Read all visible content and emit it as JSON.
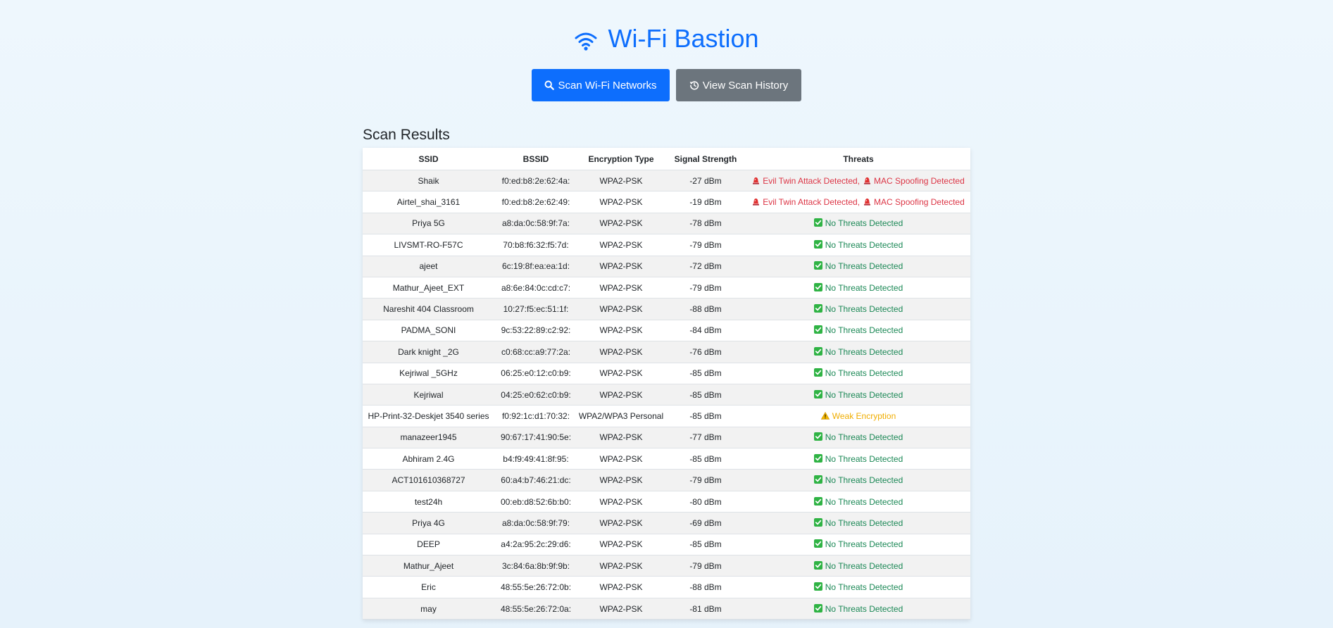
{
  "header": {
    "title": "Wi-Fi Bastion",
    "icon": "wifi-icon",
    "accent_color": "#0d6efd"
  },
  "actions": {
    "scan_label": "Scan Wi-Fi Networks",
    "history_label": "View Scan History"
  },
  "results": {
    "title": "Scan Results",
    "columns": [
      "SSID",
      "BSSID",
      "Encryption Type",
      "Signal Strength",
      "Threats"
    ],
    "threat_labels": {
      "evil_twin": "Evil Twin Attack Detected,",
      "mac_spoof": "MAC Spoofing Detected",
      "none": "No Threats Detected",
      "weak": "Weak Encryption"
    },
    "rows": [
      {
        "ssid": "Shaik",
        "bssid": "f0:ed:b8:2e:62:4a:",
        "encryption": "WPA2-PSK",
        "signal": "-27 dBm",
        "threat": "danger"
      },
      {
        "ssid": "Airtel_shai_3161",
        "bssid": "f0:ed:b8:2e:62:49:",
        "encryption": "WPA2-PSK",
        "signal": "-19 dBm",
        "threat": "danger"
      },
      {
        "ssid": "Priya 5G",
        "bssid": "a8:da:0c:58:9f:7a:",
        "encryption": "WPA2-PSK",
        "signal": "-78 dBm",
        "threat": "none"
      },
      {
        "ssid": "LIVSMT-RO-F57C",
        "bssid": "70:b8:f6:32:f5:7d:",
        "encryption": "WPA2-PSK",
        "signal": "-79 dBm",
        "threat": "none"
      },
      {
        "ssid": "ajeet",
        "bssid": "6c:19:8f:ea:ea:1d:",
        "encryption": "WPA2-PSK",
        "signal": "-72 dBm",
        "threat": "none"
      },
      {
        "ssid": "Mathur_Ajeet_EXT",
        "bssid": "a8:6e:84:0c:cd:c7:",
        "encryption": "WPA2-PSK",
        "signal": "-79 dBm",
        "threat": "none"
      },
      {
        "ssid": "Nareshit 404 Classroom",
        "bssid": "10:27:f5:ec:51:1f:",
        "encryption": "WPA2-PSK",
        "signal": "-88 dBm",
        "threat": "none"
      },
      {
        "ssid": "PADMA_SONI",
        "bssid": "9c:53:22:89:c2:92:",
        "encryption": "WPA2-PSK",
        "signal": "-84 dBm",
        "threat": "none"
      },
      {
        "ssid": "Dark knight _2G",
        "bssid": "c0:68:cc:a9:77:2a:",
        "encryption": "WPA2-PSK",
        "signal": "-76 dBm",
        "threat": "none"
      },
      {
        "ssid": "Kejriwal _5GHz",
        "bssid": "06:25:e0:12:c0:b9:",
        "encryption": "WPA2-PSK",
        "signal": "-85 dBm",
        "threat": "none"
      },
      {
        "ssid": "Kejriwal",
        "bssid": "04:25:e0:62:c0:b9:",
        "encryption": "WPA2-PSK",
        "signal": "-85 dBm",
        "threat": "none"
      },
      {
        "ssid": "HP-Print-32-Deskjet 3540 series",
        "bssid": "f0:92:1c:d1:70:32:",
        "encryption": "WPA2/WPA3 Personal",
        "signal": "-85 dBm",
        "threat": "weak"
      },
      {
        "ssid": "manazeer1945",
        "bssid": "90:67:17:41:90:5e:",
        "encryption": "WPA2-PSK",
        "signal": "-77 dBm",
        "threat": "none"
      },
      {
        "ssid": "Abhiram 2.4G",
        "bssid": "b4:f9:49:41:8f:95:",
        "encryption": "WPA2-PSK",
        "signal": "-85 dBm",
        "threat": "none"
      },
      {
        "ssid": "ACT101610368727",
        "bssid": "60:a4:b7:46:21:dc:",
        "encryption": "WPA2-PSK",
        "signal": "-79 dBm",
        "threat": "none"
      },
      {
        "ssid": "test24h",
        "bssid": "00:eb:d8:52:6b:b0:",
        "encryption": "WPA2-PSK",
        "signal": "-80 dBm",
        "threat": "none"
      },
      {
        "ssid": "Priya 4G",
        "bssid": "a8:da:0c:58:9f:79:",
        "encryption": "WPA2-PSK",
        "signal": "-69 dBm",
        "threat": "none"
      },
      {
        "ssid": "DEEP",
        "bssid": "a4:2a:95:2c:29:d6:",
        "encryption": "WPA2-PSK",
        "signal": "-85 dBm",
        "threat": "none"
      },
      {
        "ssid": "Mathur_Ajeet",
        "bssid": "3c:84:6a:8b:9f:9b:",
        "encryption": "WPA2-PSK",
        "signal": "-79 dBm",
        "threat": "none"
      },
      {
        "ssid": "Eric",
        "bssid": "48:55:5e:26:72:0b:",
        "encryption": "WPA2-PSK",
        "signal": "-88 dBm",
        "threat": "none"
      },
      {
        "ssid": "may",
        "bssid": "48:55:5e:26:72:0a:",
        "encryption": "WPA2-PSK",
        "signal": "-81 dBm",
        "threat": "none"
      }
    ]
  },
  "colors": {
    "danger": "#dc3545",
    "success": "#198754",
    "warning": "#f0ad00",
    "secondary": "#6c757d"
  }
}
